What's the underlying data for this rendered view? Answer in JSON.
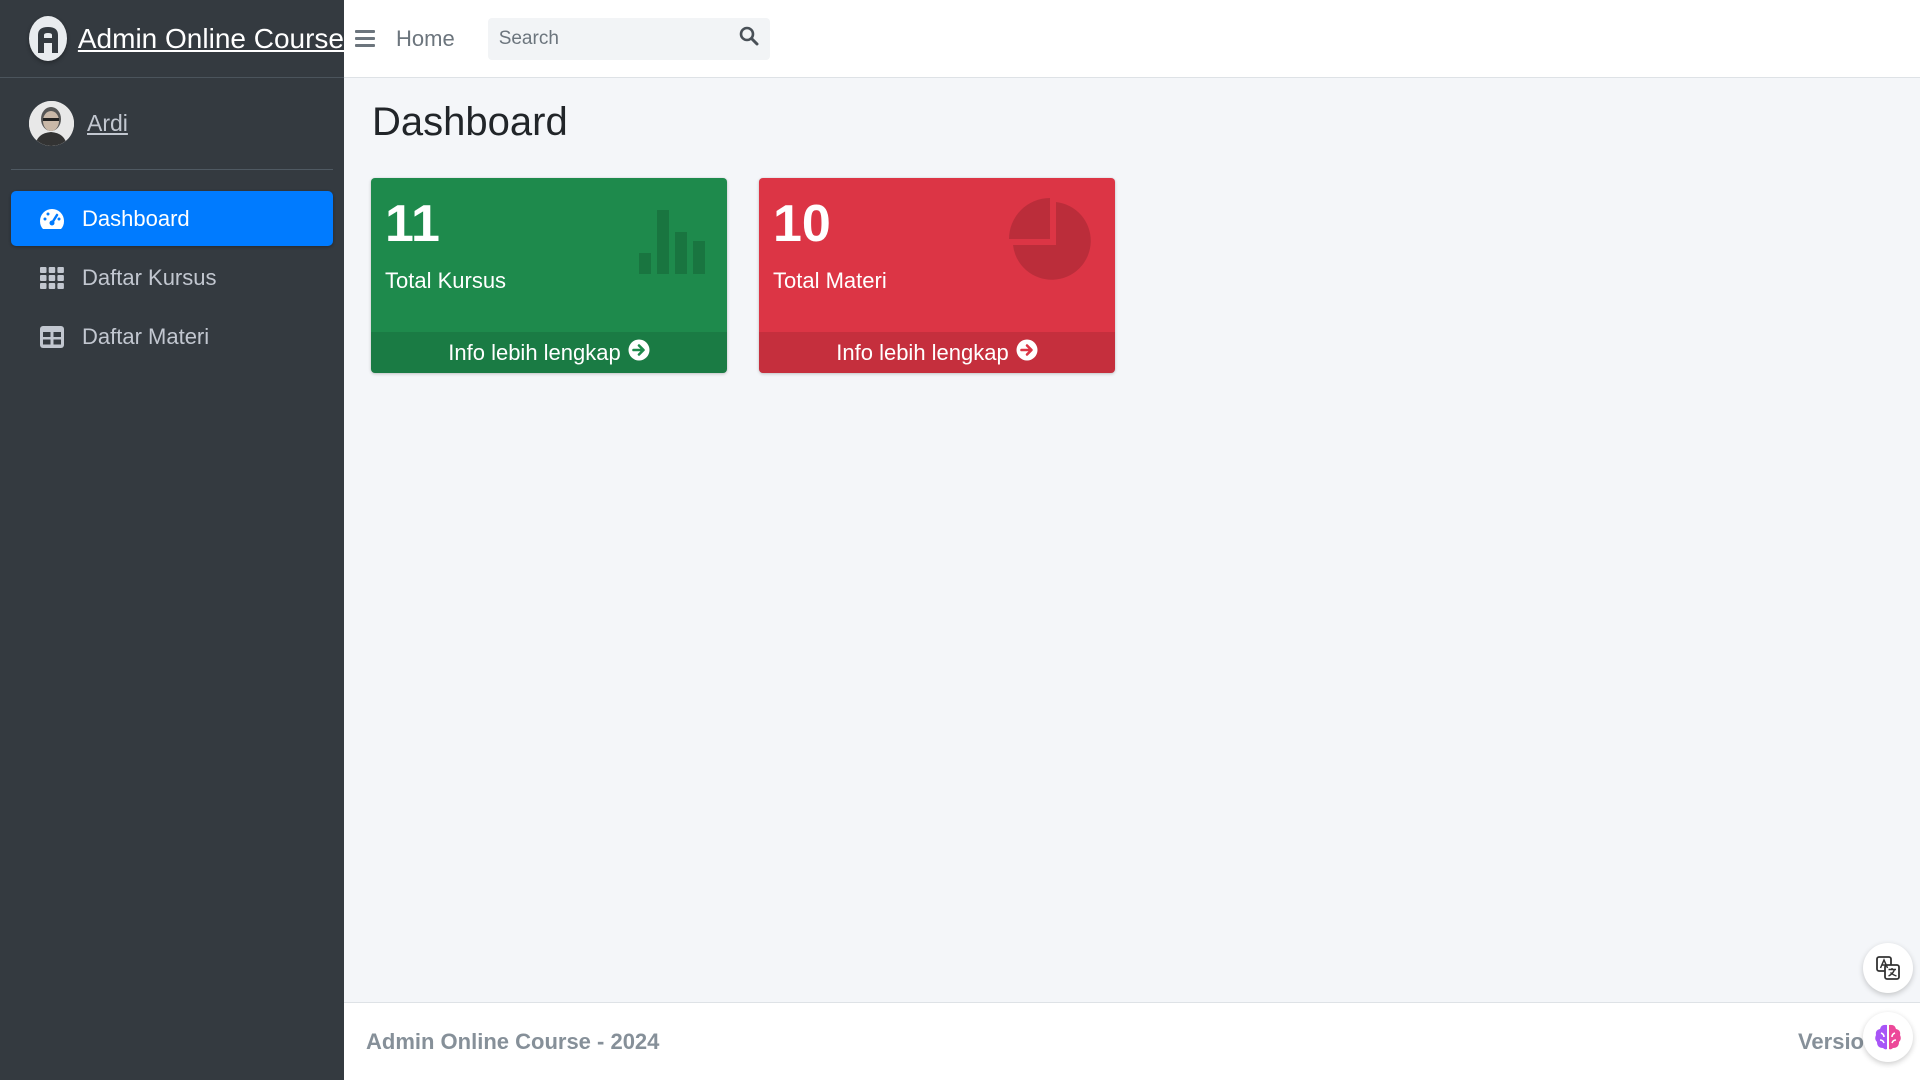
{
  "brand": {
    "title": "Admin Online Course"
  },
  "user": {
    "name": "Ardi"
  },
  "sidebar": {
    "items": [
      {
        "label": "Dashboard",
        "icon": "tachometer-icon",
        "active": true
      },
      {
        "label": "Daftar Kursus",
        "icon": "grid-icon",
        "active": false
      },
      {
        "label": "Daftar Materi",
        "icon": "table-icon",
        "active": false
      }
    ]
  },
  "header": {
    "home_label": "Home",
    "search_placeholder": "Search"
  },
  "main": {
    "page_title": "Dashboard",
    "cards": [
      {
        "value": "11",
        "label": "Total Kursus",
        "link": "Info lebih lengkap",
        "color": "#1e8a4c",
        "icon": "bar-chart-icon"
      },
      {
        "value": "10",
        "label": "Total Materi",
        "link": "Info lebih lengkap",
        "color": "#dc3545",
        "icon": "pie-chart-icon"
      }
    ]
  },
  "footer": {
    "copyright": "Admin Online Course - 2024",
    "version_label": "Versio"
  },
  "colors": {
    "sidebar": "#343a40",
    "active": "#007bff",
    "success": "#1e8a4c",
    "danger": "#dc3545"
  }
}
